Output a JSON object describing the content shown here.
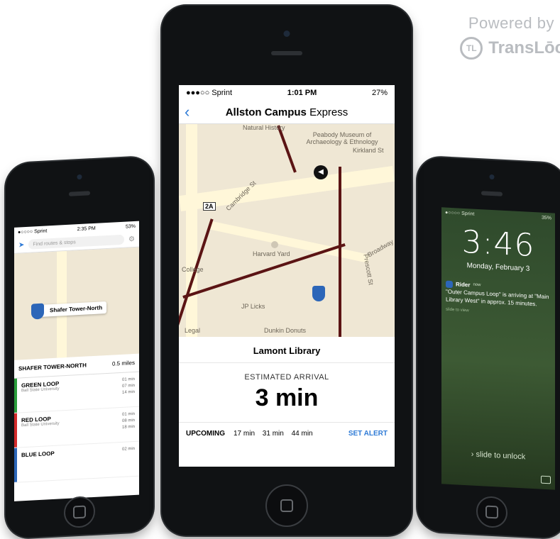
{
  "brand": {
    "powered_by": "Powered by",
    "name": "TransLōc"
  },
  "center": {
    "status": {
      "carrier": "●●●○○ Sprint",
      "time": "1:01 PM",
      "battery": "27%"
    },
    "nav": {
      "back": "‹",
      "title_bold": "Allston Campus",
      "title_rest": " Express"
    },
    "map_labels": [
      "Natural History",
      "Peabody Museum of Archaeology & Ethnology",
      "Kirkland St",
      "Cambridge St",
      "2A",
      "Harvard Yard",
      "College",
      "JP Licks",
      "Dunkin Donuts",
      "Legal",
      "Prescott St",
      "Broadway"
    ],
    "stop_name": "Lamont Library",
    "estimated_label": "ESTIMATED ARRIVAL",
    "eta": "3 min",
    "upcoming_label": "UPCOMING",
    "upcoming_times": [
      "17 min",
      "31 min",
      "44 min"
    ],
    "set_alert": "SET ALERT"
  },
  "left": {
    "status": {
      "carrier": "●○○○○ Sprint",
      "time": "2:35 PM",
      "battery": "53%"
    },
    "search_placeholder": "Find routes & stops",
    "callout": "Shafer Tower-North",
    "stop_header": "SHAFER TOWER-NORTH",
    "distance": "0.5 miles",
    "routes": [
      {
        "name": "GREEN LOOP",
        "sub": "Ball State University",
        "times": [
          "01 min",
          "07 min",
          "14 min"
        ],
        "color": "#2a9d3c"
      },
      {
        "name": "RED LOOP",
        "sub": "Ball State University",
        "times": [
          "01 min",
          "08 min",
          "18 min"
        ],
        "color": "#d22a2a"
      },
      {
        "name": "BLUE LOOP",
        "sub": "",
        "times": [
          "02 min"
        ],
        "color": "#2c66b8"
      }
    ]
  },
  "right": {
    "status": {
      "carrier": "●○○○○ Sprint",
      "battery": "35%"
    },
    "clock": "3:46",
    "date": "Monday, February 3",
    "notification": {
      "app": "Rider",
      "when": "now",
      "text": "\"Outer Campus Loop\" is arriving at \"Main Library West\" in approx. 15 minutes.",
      "action": "slide to view"
    },
    "unlock": "slide to unlock"
  }
}
